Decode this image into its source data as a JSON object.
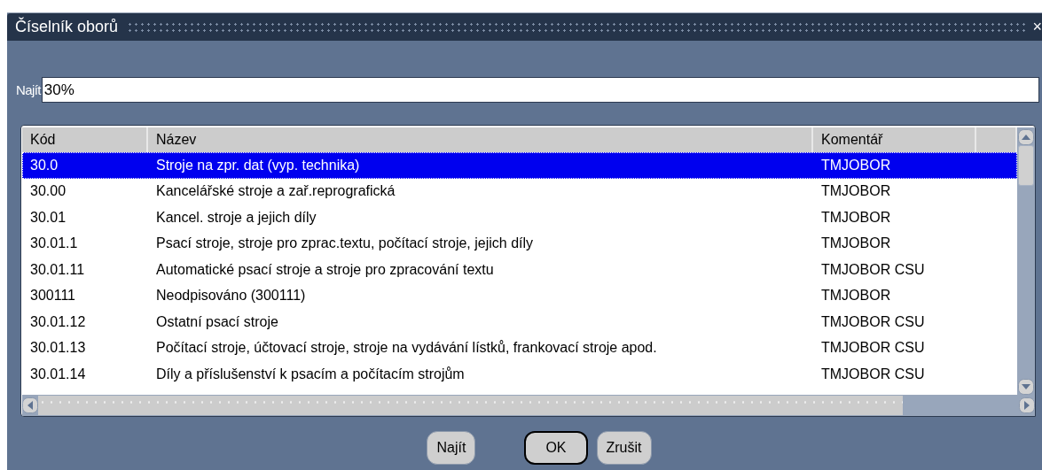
{
  "window": {
    "title": "Číselník oborů",
    "close": "×"
  },
  "search": {
    "label": "Najít",
    "value": "30%"
  },
  "table": {
    "columns": [
      "Kód",
      "Název",
      "Komentář"
    ],
    "rows": [
      {
        "cells": [
          "30.0",
          "Stroje na zpr. dat (vyp. technika)",
          "TMJOBOR"
        ],
        "selected": true
      },
      {
        "cells": [
          "30.00",
          "Kancelářské stroje a zař.reprografická",
          "TMJOBOR"
        ],
        "selected": false
      },
      {
        "cells": [
          "30.01",
          "Kancel. stroje a jejich díly",
          "TMJOBOR"
        ],
        "selected": false
      },
      {
        "cells": [
          "30.01.1",
          "Psací stroje, stroje pro zprac.textu, počítací stroje, jejich díly",
          "TMJOBOR"
        ],
        "selected": false
      },
      {
        "cells": [
          "30.01.11",
          "Automatické psací stroje a stroje pro zpracování textu",
          "TMJOBOR CSU"
        ],
        "selected": false
      },
      {
        "cells": [
          "300111",
          "Neodpisováno (300111)",
          "TMJOBOR"
        ],
        "selected": false
      },
      {
        "cells": [
          "30.01.12",
          "Ostatní psací stroje",
          "TMJOBOR CSU"
        ],
        "selected": false
      },
      {
        "cells": [
          "30.01.13",
          "Počítací stroje, účtovací stroje, stroje na vydávání lístků, frankovací stroje apod.",
          "TMJOBOR CSU"
        ],
        "selected": false
      },
      {
        "cells": [
          "30.01.14",
          "Díly a příslušenství k psacím a počítacím strojům",
          "TMJOBOR CSU"
        ],
        "selected": false
      }
    ]
  },
  "buttons": [
    {
      "label": "Najít",
      "default": false
    },
    {
      "label": "OK",
      "default": true
    },
    {
      "label": "Zrušit",
      "default": false
    }
  ]
}
